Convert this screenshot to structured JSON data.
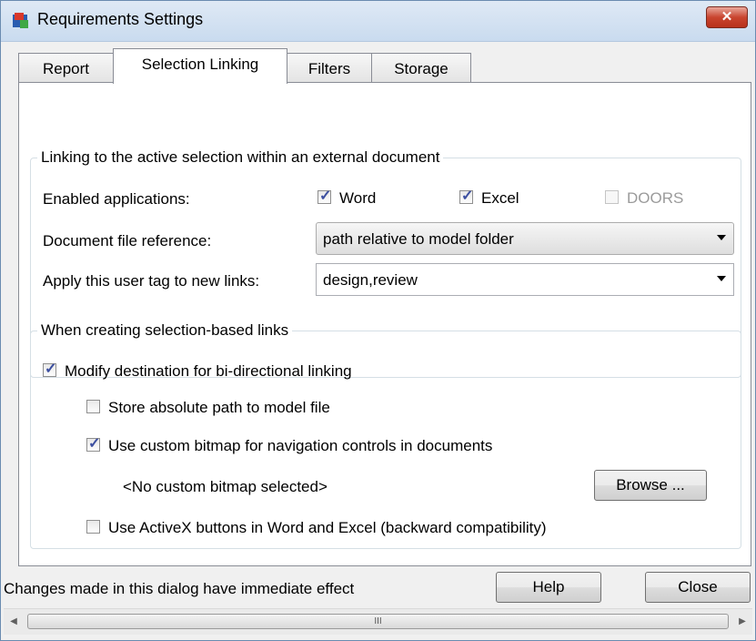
{
  "window": {
    "title": "Requirements Settings",
    "close_label": "✕"
  },
  "tabs": [
    {
      "label": "Report",
      "active": false
    },
    {
      "label": "Selection Linking",
      "active": true
    },
    {
      "label": "Filters",
      "active": false
    },
    {
      "label": "Storage",
      "active": false
    }
  ],
  "linking_group": {
    "legend": "Linking to the active selection within an external document",
    "enabled_apps_label": "Enabled applications:",
    "apps": [
      {
        "label": "Word",
        "checked": true,
        "enabled": true
      },
      {
        "label": "Excel",
        "checked": true,
        "enabled": true
      },
      {
        "label": "DOORS",
        "checked": false,
        "enabled": false
      }
    ],
    "doc_ref_label": "Document file reference:",
    "doc_ref_value": "path relative to model folder",
    "user_tag_label": "Apply this user tag to new links:",
    "user_tag_value": "design,review"
  },
  "creating_group": {
    "legend": "When creating selection-based links",
    "modify_dest": {
      "label": "Modify destination for bi-directional linking",
      "checked": true
    },
    "store_abs": {
      "label": "Store absolute path to model file",
      "checked": false
    },
    "custom_bitmap": {
      "label": "Use custom bitmap for navigation controls in documents",
      "checked": true
    },
    "bitmap_status": "<No custom bitmap selected>",
    "browse_label": "Browse ...",
    "activex": {
      "label": "Use ActiveX buttons in Word and Excel (backward compatibility)",
      "checked": false
    }
  },
  "footer": {
    "note": "Changes made in this dialog have immediate effect",
    "help_label": "Help",
    "close_label": "Close"
  },
  "scrollbar": {
    "left_arrow": "◀",
    "right_arrow": "▶",
    "grip": "III"
  },
  "colors": {
    "check_mark": "#3c4fa0",
    "close_red": "#c9452f",
    "title_bar": "#c9dbef"
  }
}
